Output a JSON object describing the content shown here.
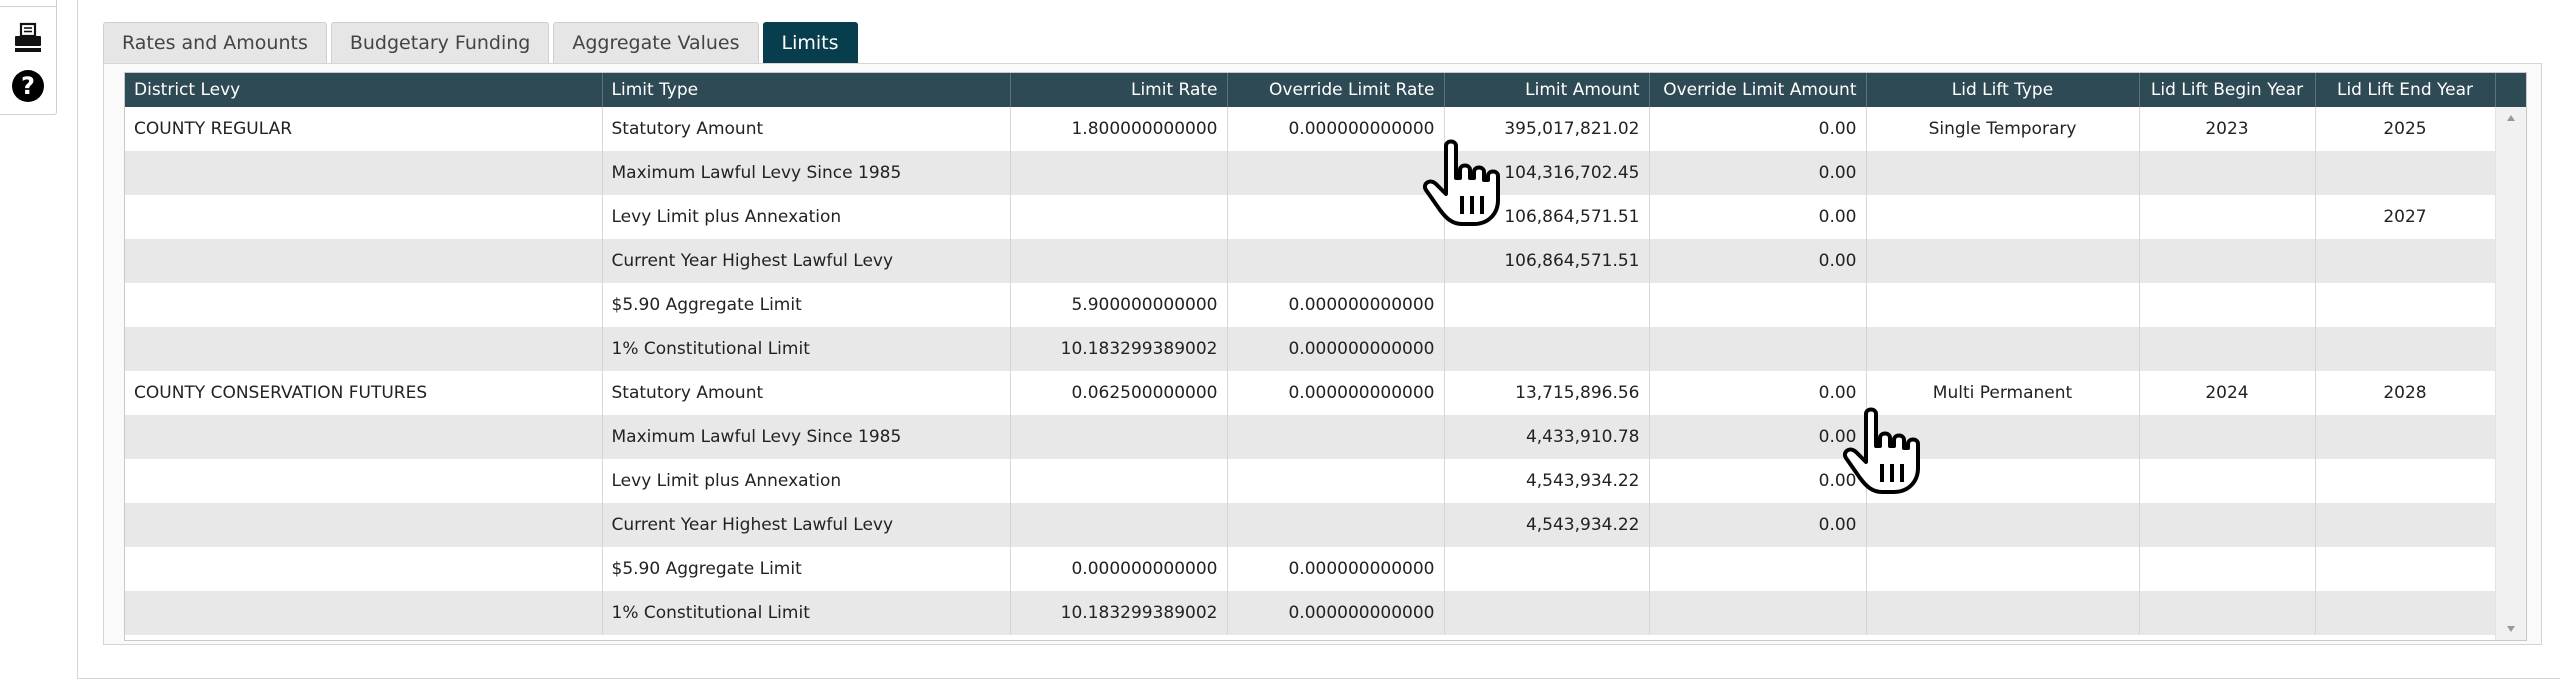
{
  "rail": {
    "print_icon": "printer-icon",
    "help_icon": "question-circle-icon",
    "help_glyph": "?"
  },
  "tabs": [
    {
      "label": "Rates and Amounts",
      "active": false
    },
    {
      "label": "Budgetary Funding",
      "active": false
    },
    {
      "label": "Aggregate Values",
      "active": false
    },
    {
      "label": "Limits",
      "active": true
    }
  ],
  "table": {
    "columns": [
      "District Levy",
      "Limit Type",
      "Limit Rate",
      "Override Limit Rate",
      "Limit Amount",
      "Override Limit Amount",
      "Lid Lift Type",
      "Lid Lift Begin Year",
      "Lid Lift End Year"
    ],
    "rows": [
      [
        "COUNTY REGULAR",
        "Statutory Amount",
        "1.800000000000",
        "0.000000000000",
        "395,017,821.02",
        "0.00",
        "Single Temporary",
        "2023",
        "2025"
      ],
      [
        "",
        "Maximum Lawful Levy Since 1985",
        "",
        "",
        "104,316,702.45",
        "0.00",
        "",
        "",
        ""
      ],
      [
        "",
        "Levy Limit plus Annexation",
        "",
        "",
        "106,864,571.51",
        "0.00",
        "",
        "",
        "2027"
      ],
      [
        "",
        "Current Year Highest Lawful Levy",
        "",
        "",
        "106,864,571.51",
        "0.00",
        "",
        "",
        ""
      ],
      [
        "",
        "$5.90 Aggregate Limit",
        "5.900000000000",
        "0.000000000000",
        "",
        "",
        "",
        "",
        ""
      ],
      [
        "",
        "1% Constitutional Limit",
        "10.183299389002",
        "0.000000000000",
        "",
        "",
        "",
        "",
        ""
      ],
      [
        "COUNTY CONSERVATION FUTURES",
        "Statutory Amount",
        "0.062500000000",
        "0.000000000000",
        "13,715,896.56",
        "0.00",
        "Multi Permanent",
        "2024",
        "2028"
      ],
      [
        "",
        "Maximum Lawful Levy Since 1985",
        "",
        "",
        "4,433,910.78",
        "0.00",
        "",
        "",
        ""
      ],
      [
        "",
        "Levy Limit plus Annexation",
        "",
        "",
        "4,543,934.22",
        "0.00",
        "",
        "",
        ""
      ],
      [
        "",
        "Current Year Highest Lawful Levy",
        "",
        "",
        "4,543,934.22",
        "0.00",
        "",
        "",
        ""
      ],
      [
        "",
        "$5.90 Aggregate Limit",
        "0.000000000000",
        "0.000000000000",
        "",
        "",
        "",
        "",
        ""
      ],
      [
        "",
        "1% Constitutional Limit",
        "10.183299389002",
        "0.000000000000",
        "",
        "",
        "",
        "",
        ""
      ]
    ]
  },
  "colors": {
    "tab_active": "#083d4d",
    "header_bg": "#2e4a55",
    "row_alt": "#e8e8e8"
  }
}
